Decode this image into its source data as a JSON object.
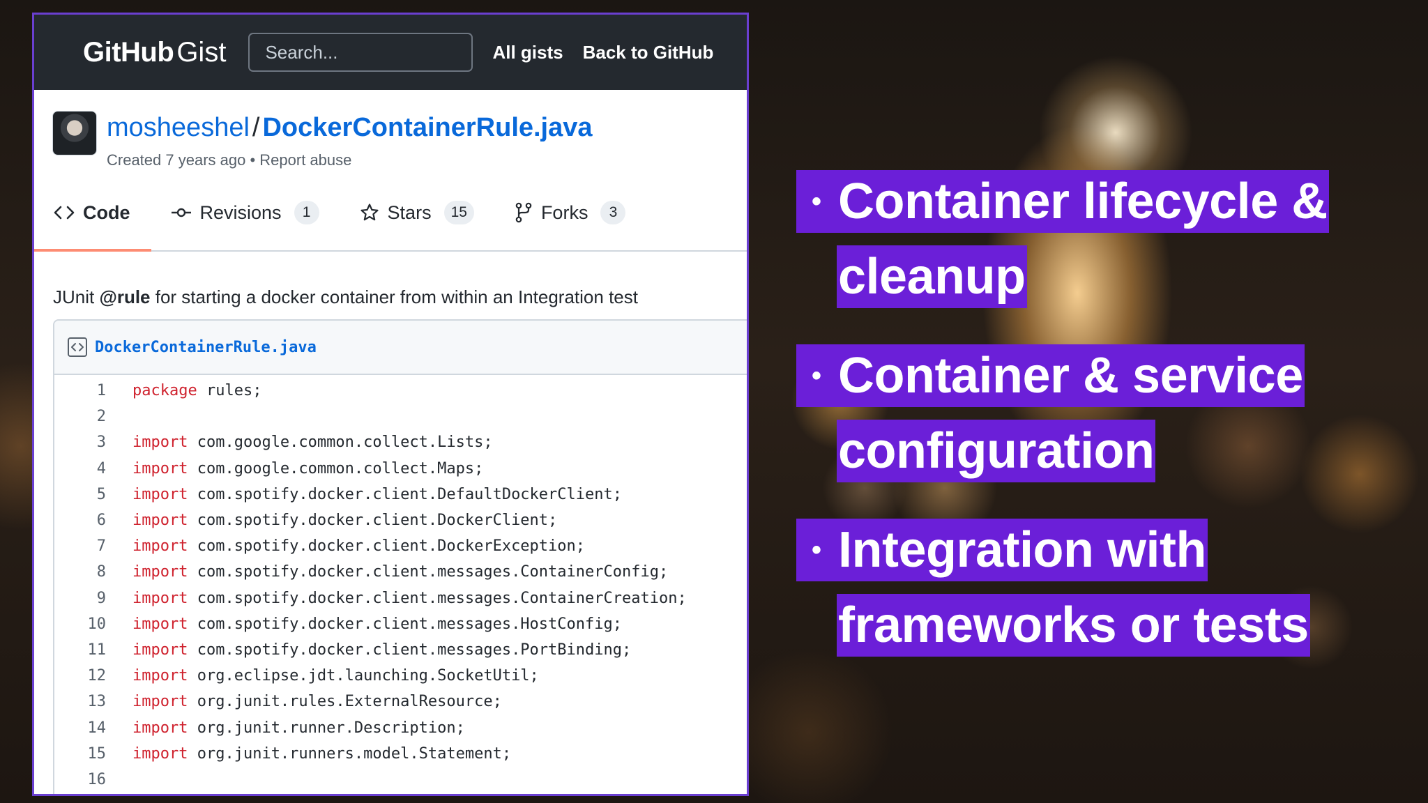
{
  "header": {
    "logo_primary": "GitHub",
    "logo_secondary": "Gist",
    "search_placeholder": "Search...",
    "links": [
      "All gists",
      "Back to GitHub"
    ]
  },
  "gist": {
    "owner": "mosheeshel",
    "separator": "/",
    "filename": "DockerContainerRule.java",
    "created": "Created 7 years ago",
    "meta_separator": "•",
    "report": "Report abuse"
  },
  "tabs": [
    {
      "label": "Code",
      "icon": "code-icon",
      "active": true
    },
    {
      "label": "Revisions",
      "count": "1",
      "icon": "commit-icon"
    },
    {
      "label": "Stars",
      "count": "15",
      "icon": "star-icon"
    },
    {
      "label": "Forks",
      "count": "3",
      "icon": "fork-icon"
    }
  ],
  "description": {
    "before": "JUnit ",
    "bold": "@rule",
    "after": " for starting a docker container from within an Integration test"
  },
  "file": {
    "name": "DockerContainerRule.java",
    "lines": [
      {
        "n": "1",
        "kw": "package",
        "rest": " rules;"
      },
      {
        "n": "2",
        "kw": "",
        "rest": ""
      },
      {
        "n": "3",
        "kw": "import",
        "rest": " com.google.common.collect.Lists;"
      },
      {
        "n": "4",
        "kw": "import",
        "rest": " com.google.common.collect.Maps;"
      },
      {
        "n": "5",
        "kw": "import",
        "rest": " com.spotify.docker.client.DefaultDockerClient;"
      },
      {
        "n": "6",
        "kw": "import",
        "rest": " com.spotify.docker.client.DockerClient;"
      },
      {
        "n": "7",
        "kw": "import",
        "rest": " com.spotify.docker.client.DockerException;"
      },
      {
        "n": "8",
        "kw": "import",
        "rest": " com.spotify.docker.client.messages.ContainerConfig;"
      },
      {
        "n": "9",
        "kw": "import",
        "rest": " com.spotify.docker.client.messages.ContainerCreation;"
      },
      {
        "n": "10",
        "kw": "import",
        "rest": " com.spotify.docker.client.messages.HostConfig;"
      },
      {
        "n": "11",
        "kw": "import",
        "rest": " com.spotify.docker.client.messages.PortBinding;"
      },
      {
        "n": "12",
        "kw": "import",
        "rest": " org.eclipse.jdt.launching.SocketUtil;"
      },
      {
        "n": "13",
        "kw": "import",
        "rest": " org.junit.rules.ExternalResource;"
      },
      {
        "n": "14",
        "kw": "import",
        "rest": " org.junit.runner.Description;"
      },
      {
        "n": "15",
        "kw": "import",
        "rest": " org.junit.runners.model.Statement;"
      },
      {
        "n": "16",
        "kw": "",
        "rest": ""
      }
    ]
  },
  "bullets": [
    {
      "marker": "•",
      "line1": "Container lifecycle &",
      "line2": "cleanup"
    },
    {
      "marker": "•",
      "line1": "Container & service",
      "line2": "configuration"
    },
    {
      "marker": "•",
      "line1": "Integration with",
      "line2": "frameworks or tests"
    }
  ],
  "colors": {
    "accent_purple": "#6b1fd8",
    "link_blue": "#0969da",
    "keyword_red": "#cf222e",
    "header_dark": "#24292f",
    "active_tab_underline": "#fd8c73"
  }
}
